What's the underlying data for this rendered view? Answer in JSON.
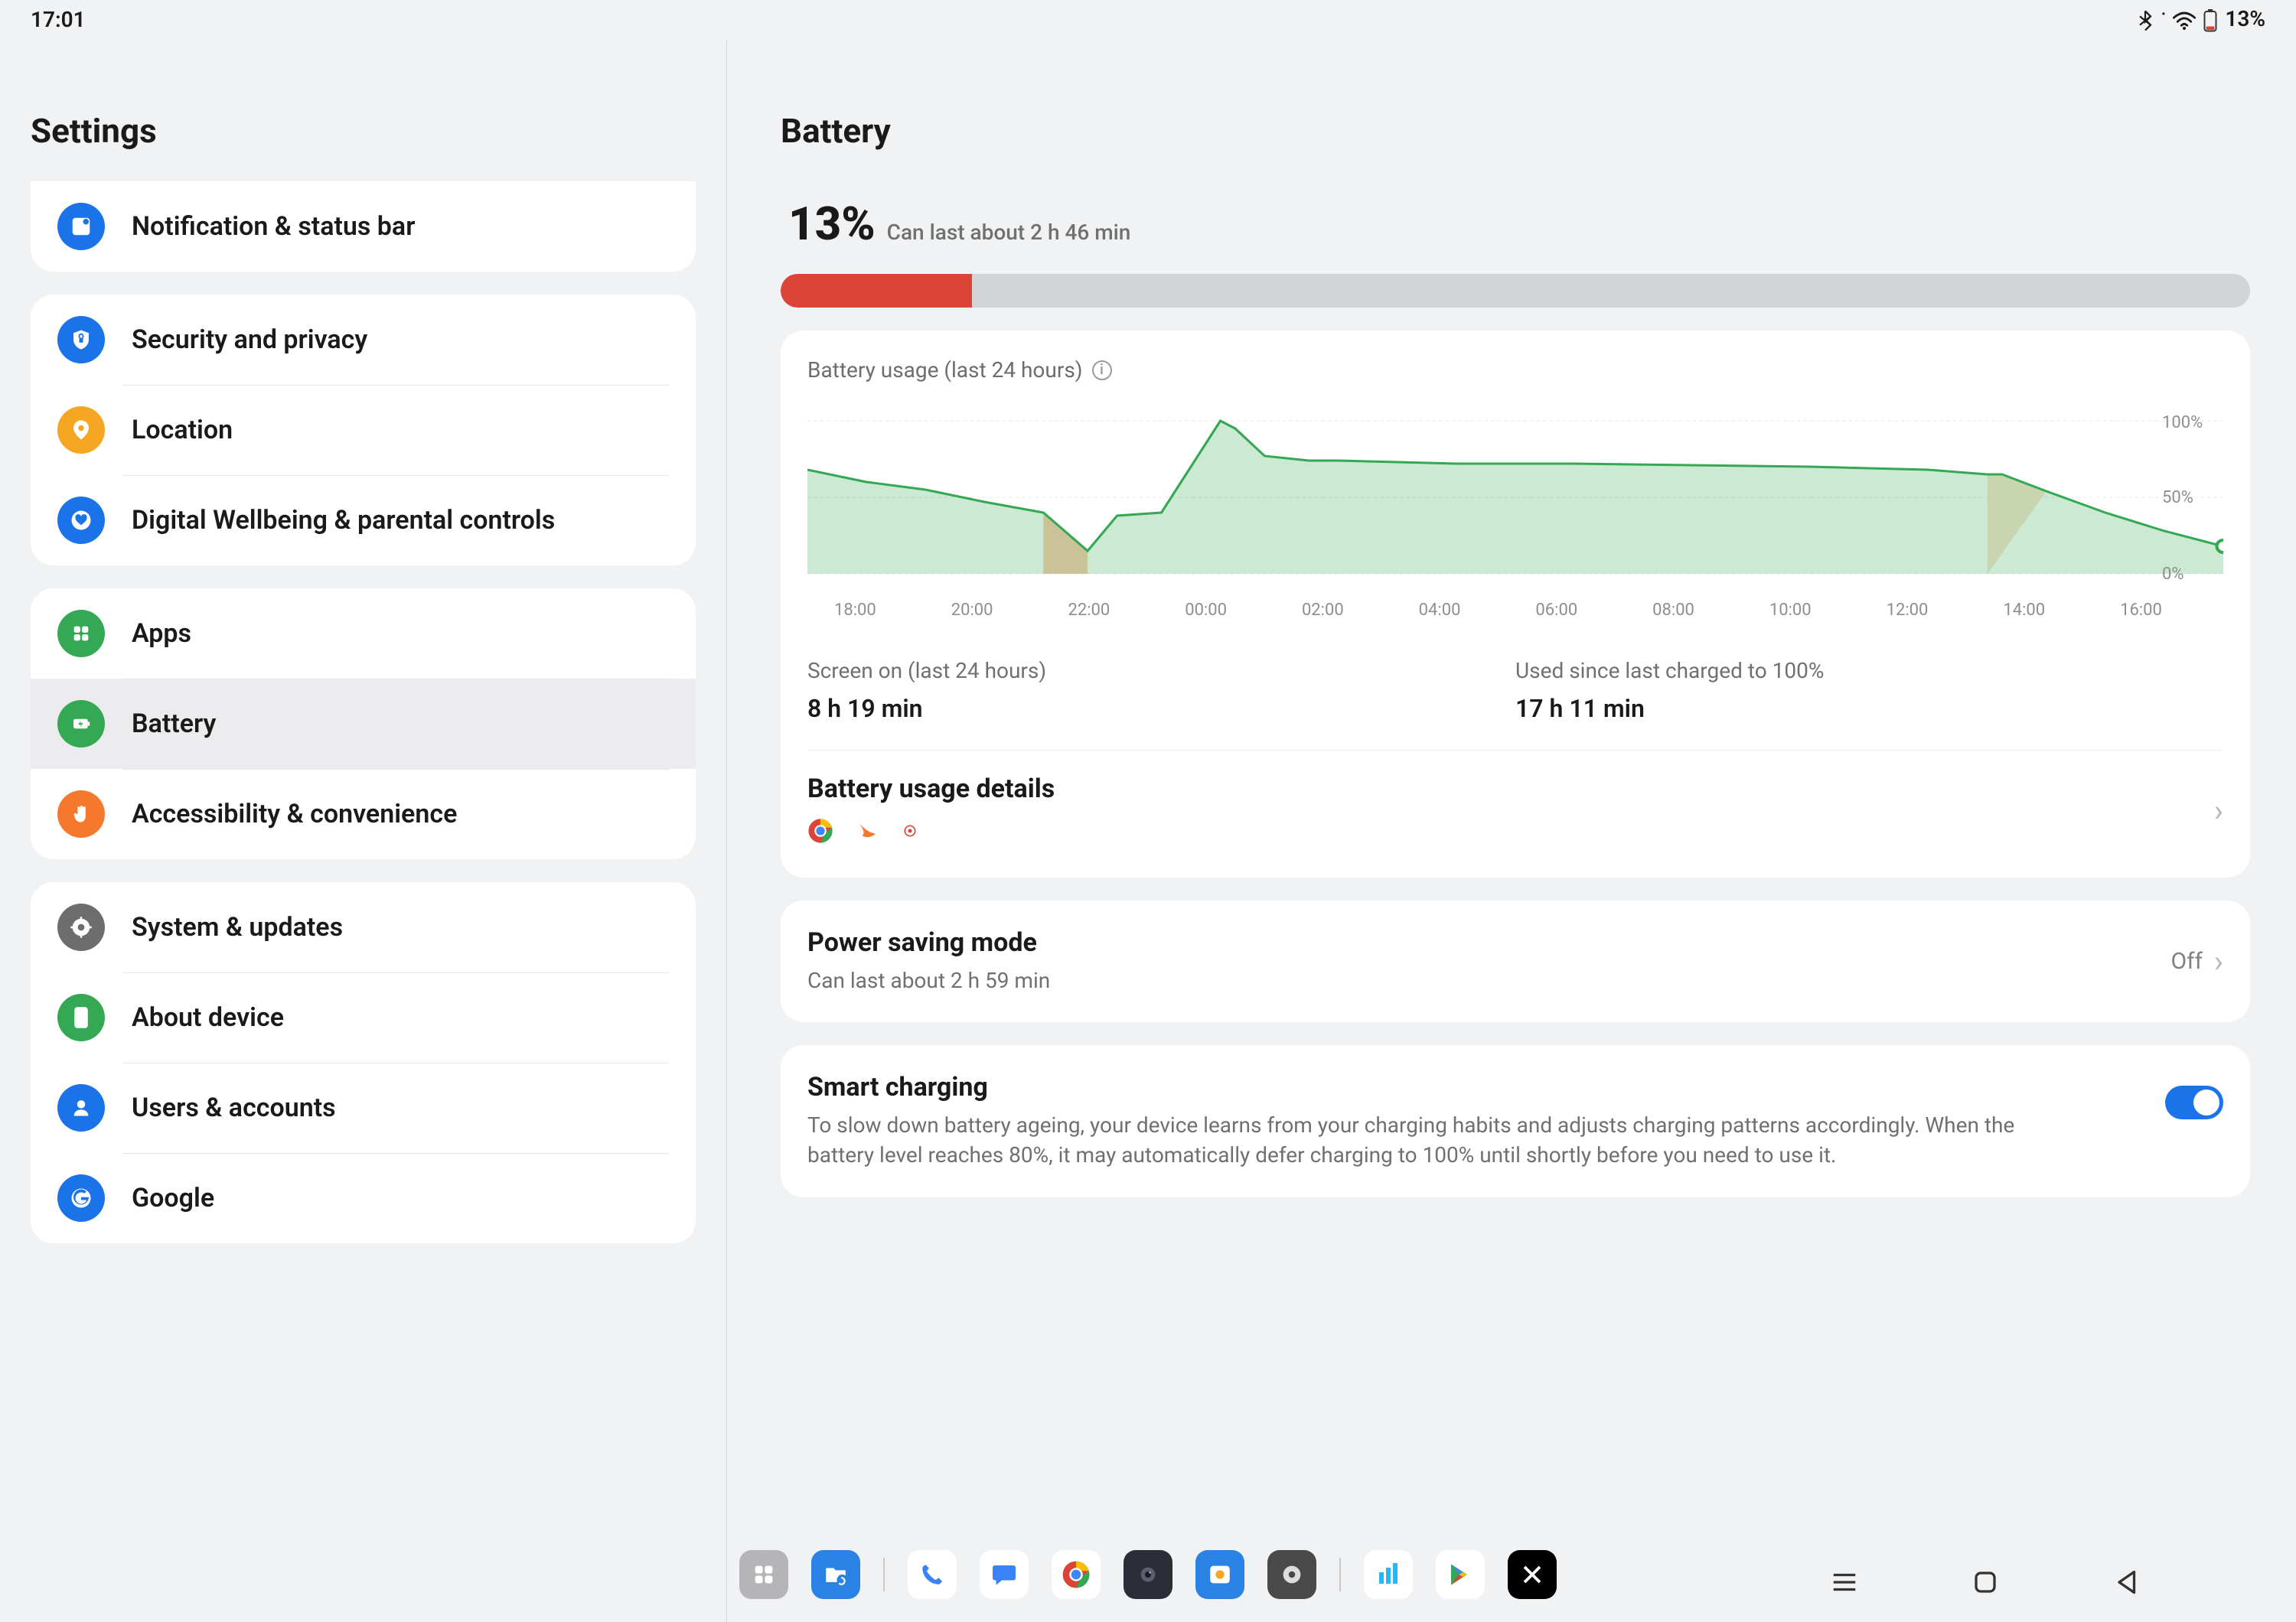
{
  "status": {
    "time": "17:01",
    "battery_text": "13%"
  },
  "left_title": "Settings",
  "sidebar": {
    "group1": [
      {
        "label": "Notification & status bar",
        "color": "#1a73e8",
        "icon": "notification"
      }
    ],
    "group2": [
      {
        "label": "Security and privacy",
        "color": "#1a73e8",
        "icon": "shield"
      },
      {
        "label": "Location",
        "color": "#f5a623",
        "icon": "pin"
      },
      {
        "label": "Digital Wellbeing & parental controls",
        "color": "#1a73e8",
        "icon": "heart"
      }
    ],
    "group3": [
      {
        "label": "Apps",
        "color": "#34a853",
        "icon": "grid"
      },
      {
        "label": "Battery",
        "color": "#34a853",
        "icon": "battery",
        "selected": true
      },
      {
        "label": "Accessibility & convenience",
        "color": "#f5782d",
        "icon": "hand"
      }
    ],
    "group4": [
      {
        "label": "System & updates",
        "color": "#6d6d6d",
        "icon": "gear"
      },
      {
        "label": "About device",
        "color": "#34a853",
        "icon": "phone"
      },
      {
        "label": "Users & accounts",
        "color": "#1a73e8",
        "icon": "user"
      },
      {
        "label": "Google",
        "color": "#1a73e8",
        "icon": "google"
      }
    ]
  },
  "right_title": "Battery",
  "battery": {
    "percent": "13%",
    "subtitle": "Can last about 2 h 46 min",
    "fill_percent": 13
  },
  "usage": {
    "title": "Battery usage (last 24 hours)",
    "screen_on_label": "Screen on (last 24 hours)",
    "screen_on_value": "8 h 19 min",
    "used_since_label": "Used since last charged to 100%",
    "used_since_value": "17 h 11 min",
    "details_title": "Battery usage details"
  },
  "power_saving": {
    "title": "Power saving mode",
    "subtitle": "Can last about 2 h 59 min",
    "state": "Off"
  },
  "smart_charging": {
    "title": "Smart charging",
    "desc": "To slow down battery ageing, your device learns from your charging habits and adjusts charging patterns accordingly. When the battery level reaches 80%, it may automatically defer charging to 100% until shortly before you need to use it.",
    "state": "on"
  },
  "chart_data": {
    "type": "area",
    "title": "Battery usage (last 24 hours)",
    "xlabel": "",
    "ylabel": "",
    "ylim": [
      0,
      100
    ],
    "x_ticks": [
      "18:00",
      "20:00",
      "22:00",
      "00:00",
      "02:00",
      "04:00",
      "06:00",
      "08:00",
      "10:00",
      "12:00",
      "14:00",
      "16:00"
    ],
    "y_ticks": [
      "100%",
      "50%",
      "0%"
    ],
    "series": [
      {
        "name": "battery_level_percent_last_24h",
        "x": [
          "17:00",
          "18:00",
          "19:00",
          "20:00",
          "21:00",
          "21:45",
          "22:15",
          "23:00",
          "00:00",
          "00:15",
          "00:45",
          "01:30",
          "02:00",
          "04:00",
          "06:00",
          "08:00",
          "10:00",
          "12:00",
          "13:00",
          "13:15",
          "14:00",
          "15:00",
          "16:00",
          "17:00"
        ],
        "y": [
          68,
          60,
          55,
          47,
          40,
          15,
          38,
          40,
          100,
          95,
          77,
          74,
          74,
          72,
          72,
          71,
          70,
          68,
          65,
          65,
          54,
          40,
          28,
          18
        ]
      }
    ],
    "annotations": [
      {
        "type": "low_range",
        "from": "21:00",
        "to": "21:45",
        "color": "#f5a05a"
      },
      {
        "type": "low_range",
        "from": "13:00",
        "to": "14:00",
        "color": "#f5a05a"
      },
      {
        "type": "endpoint_marker",
        "x": "17:00",
        "y": 18,
        "color": "#34a853"
      }
    ]
  }
}
